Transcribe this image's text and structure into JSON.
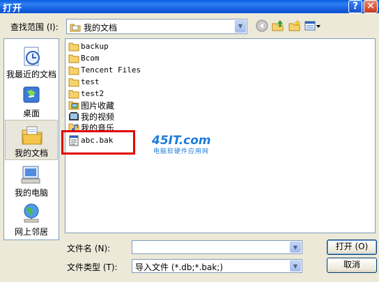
{
  "window": {
    "title": "打开",
    "help_label": "?",
    "close_label": "✕"
  },
  "lookin": {
    "label": "查找范围 (I):",
    "value": "我的文档"
  },
  "places": [
    {
      "label": "我最近的文档",
      "icon": "recent-documents-icon"
    },
    {
      "label": "桌面",
      "icon": "desktop-icon"
    },
    {
      "label": "我的文档",
      "icon": "my-documents-icon",
      "selected": true
    },
    {
      "label": "我的电脑",
      "icon": "my-computer-icon"
    },
    {
      "label": "网上邻居",
      "icon": "network-places-icon"
    }
  ],
  "files": [
    {
      "name": "backup",
      "icon": "folder-icon"
    },
    {
      "name": "Bcom",
      "icon": "folder-icon"
    },
    {
      "name": "Tencent Files",
      "icon": "folder-icon"
    },
    {
      "name": "test",
      "icon": "folder-icon"
    },
    {
      "name": "test2",
      "icon": "folder-icon"
    },
    {
      "name": "图片收藏",
      "icon": "pictures-folder-icon"
    },
    {
      "name": "我的视频",
      "icon": "videos-folder-icon"
    },
    {
      "name": "我的音乐",
      "icon": "music-folder-icon"
    },
    {
      "name": "abc.bak",
      "icon": "bak-file-icon"
    }
  ],
  "watermark": {
    "logo": "45IT.com",
    "sub": "电脑软硬件应用网"
  },
  "filename": {
    "label": "文件名 (N):",
    "value": ""
  },
  "filetype": {
    "label": "文件类型 (T):",
    "value": "导入文件 (*.db;*.bak;)"
  },
  "buttons": {
    "open": "打开 (O)",
    "cancel": "取消"
  },
  "colors": {
    "titlebar": "#0a5fe0",
    "highlight_box": "#e00000",
    "dialog_bg": "#ece9d8"
  }
}
